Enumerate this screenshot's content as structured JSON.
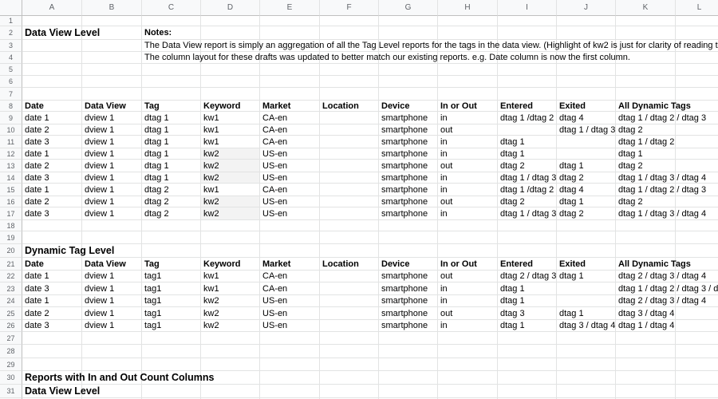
{
  "sheet": {
    "columns": [
      "A",
      "B",
      "C",
      "D",
      "E",
      "F",
      "G",
      "H",
      "I",
      "J",
      "K",
      "L"
    ],
    "rows": [
      {
        "n": "1",
        "cells": []
      },
      {
        "n": "2",
        "cells": [
          {
            "c": 0,
            "v": "Data View Level",
            "s": "big"
          },
          {
            "c": 2,
            "v": "Notes:",
            "s": "bold"
          }
        ]
      },
      {
        "n": "3",
        "cells": [
          {
            "c": 2,
            "v": "The Data View report is simply an aggregation of all the Tag Level reports for the tags in the data view. (Highlight of kw2 is just for clarity of reading this"
          }
        ]
      },
      {
        "n": "4",
        "cells": [
          {
            "c": 2,
            "v": "The column layout for these drafts was updated to better match our existing reports. e.g. Date column is now the first column."
          }
        ]
      },
      {
        "n": "5",
        "cells": []
      },
      {
        "n": "6",
        "cells": []
      },
      {
        "n": "7",
        "cells": []
      },
      {
        "n": "8",
        "cells": [
          {
            "c": 0,
            "v": "Date",
            "s": "bold"
          },
          {
            "c": 1,
            "v": "Data View",
            "s": "bold"
          },
          {
            "c": 2,
            "v": "Tag",
            "s": "bold"
          },
          {
            "c": 3,
            "v": "Keyword",
            "s": "bold"
          },
          {
            "c": 4,
            "v": "Market",
            "s": "bold"
          },
          {
            "c": 5,
            "v": "Location",
            "s": "bold"
          },
          {
            "c": 6,
            "v": "Device",
            "s": "bold"
          },
          {
            "c": 7,
            "v": "In or Out",
            "s": "bold"
          },
          {
            "c": 8,
            "v": "Entered",
            "s": "bold"
          },
          {
            "c": 9,
            "v": "Exited",
            "s": "bold"
          },
          {
            "c": 10,
            "v": "All Dynamic Tags",
            "s": "bold"
          }
        ]
      },
      {
        "n": "9",
        "cells": [
          {
            "c": 0,
            "v": "date 1"
          },
          {
            "c": 1,
            "v": "dview 1"
          },
          {
            "c": 2,
            "v": "dtag 1"
          },
          {
            "c": 3,
            "v": "kw1"
          },
          {
            "c": 4,
            "v": "CA-en"
          },
          {
            "c": 6,
            "v": "smartphone"
          },
          {
            "c": 7,
            "v": "in"
          },
          {
            "c": 8,
            "v": "dtag 1 /dtag 2"
          },
          {
            "c": 9,
            "v": "dtag 4"
          },
          {
            "c": 10,
            "v": "dtag 1 / dtag 2 / dtag 3"
          }
        ]
      },
      {
        "n": "10",
        "cells": [
          {
            "c": 0,
            "v": "date 2"
          },
          {
            "c": 1,
            "v": "dview 1"
          },
          {
            "c": 2,
            "v": "dtag 1"
          },
          {
            "c": 3,
            "v": "kw1"
          },
          {
            "c": 4,
            "v": "CA-en"
          },
          {
            "c": 6,
            "v": "smartphone"
          },
          {
            "c": 7,
            "v": "out"
          },
          {
            "c": 9,
            "v": "dtag 1 / dtag 3"
          },
          {
            "c": 10,
            "v": "dtag 2"
          }
        ]
      },
      {
        "n": "11",
        "cells": [
          {
            "c": 0,
            "v": "date 3"
          },
          {
            "c": 1,
            "v": "dview 1"
          },
          {
            "c": 2,
            "v": "dtag 1"
          },
          {
            "c": 3,
            "v": "kw1"
          },
          {
            "c": 4,
            "v": "CA-en"
          },
          {
            "c": 6,
            "v": "smartphone"
          },
          {
            "c": 7,
            "v": "in"
          },
          {
            "c": 8,
            "v": "dtag 1"
          },
          {
            "c": 10,
            "v": "dtag 1 / dtag 2"
          }
        ]
      },
      {
        "n": "12",
        "cells": [
          {
            "c": 0,
            "v": "date 1"
          },
          {
            "c": 1,
            "v": "dview 1"
          },
          {
            "c": 2,
            "v": "dtag 1"
          },
          {
            "c": 3,
            "v": "kw2",
            "s": "shade"
          },
          {
            "c": 4,
            "v": "US-en"
          },
          {
            "c": 6,
            "v": "smartphone"
          },
          {
            "c": 7,
            "v": "in"
          },
          {
            "c": 8,
            "v": "dtag 1"
          },
          {
            "c": 10,
            "v": "dtag 1"
          }
        ]
      },
      {
        "n": "13",
        "cells": [
          {
            "c": 0,
            "v": "date 2"
          },
          {
            "c": 1,
            "v": "dview 1"
          },
          {
            "c": 2,
            "v": "dtag 1"
          },
          {
            "c": 3,
            "v": "kw2",
            "s": "shade"
          },
          {
            "c": 4,
            "v": "US-en"
          },
          {
            "c": 6,
            "v": "smartphone"
          },
          {
            "c": 7,
            "v": "out"
          },
          {
            "c": 8,
            "v": "dtag 2"
          },
          {
            "c": 9,
            "v": "dtag 1"
          },
          {
            "c": 10,
            "v": "dtag 2"
          }
        ]
      },
      {
        "n": "14",
        "cells": [
          {
            "c": 0,
            "v": "date 3"
          },
          {
            "c": 1,
            "v": "dview 1"
          },
          {
            "c": 2,
            "v": "dtag 1"
          },
          {
            "c": 3,
            "v": "kw2",
            "s": "shade"
          },
          {
            "c": 4,
            "v": "US-en"
          },
          {
            "c": 6,
            "v": "smartphone"
          },
          {
            "c": 7,
            "v": "in"
          },
          {
            "c": 8,
            "v": "dtag 1 / dtag 3"
          },
          {
            "c": 9,
            "v": "dtag 2"
          },
          {
            "c": 10,
            "v": "dtag 1 / dtag 3 / dtag 4"
          }
        ]
      },
      {
        "n": "15",
        "cells": [
          {
            "c": 0,
            "v": "date 1"
          },
          {
            "c": 1,
            "v": "dview 1"
          },
          {
            "c": 2,
            "v": "dtag 2"
          },
          {
            "c": 3,
            "v": "kw1"
          },
          {
            "c": 4,
            "v": "CA-en"
          },
          {
            "c": 6,
            "v": "smartphone"
          },
          {
            "c": 7,
            "v": "in"
          },
          {
            "c": 8,
            "v": "dtag 1 /dtag 2"
          },
          {
            "c": 9,
            "v": "dtag 4"
          },
          {
            "c": 10,
            "v": "dtag 1 / dtag 2 / dtag 3"
          }
        ]
      },
      {
        "n": "16",
        "cells": [
          {
            "c": 0,
            "v": "date 2"
          },
          {
            "c": 1,
            "v": "dview 1"
          },
          {
            "c": 2,
            "v": "dtag 2"
          },
          {
            "c": 3,
            "v": "kw2",
            "s": "shade"
          },
          {
            "c": 4,
            "v": "US-en"
          },
          {
            "c": 6,
            "v": "smartphone"
          },
          {
            "c": 7,
            "v": "out"
          },
          {
            "c": 8,
            "v": "dtag 2"
          },
          {
            "c": 9,
            "v": "dtag 1"
          },
          {
            "c": 10,
            "v": "dtag 2"
          }
        ]
      },
      {
        "n": "17",
        "cells": [
          {
            "c": 0,
            "v": "date 3"
          },
          {
            "c": 1,
            "v": "dview 1"
          },
          {
            "c": 2,
            "v": "dtag 2"
          },
          {
            "c": 3,
            "v": "kw2",
            "s": "shade"
          },
          {
            "c": 4,
            "v": "US-en"
          },
          {
            "c": 6,
            "v": "smartphone"
          },
          {
            "c": 7,
            "v": "in"
          },
          {
            "c": 8,
            "v": "dtag 1 / dtag 3"
          },
          {
            "c": 9,
            "v": "dtag 2"
          },
          {
            "c": 10,
            "v": "dtag 1 / dtag 3 / dtag 4"
          }
        ]
      },
      {
        "n": "18",
        "cells": []
      },
      {
        "n": "19",
        "cells": []
      },
      {
        "n": "20",
        "cells": [
          {
            "c": 0,
            "v": "Dynamic Tag Level",
            "s": "big"
          }
        ]
      },
      {
        "n": "21",
        "cells": [
          {
            "c": 0,
            "v": "Date",
            "s": "bold"
          },
          {
            "c": 1,
            "v": "Data View",
            "s": "bold"
          },
          {
            "c": 2,
            "v": "Tag",
            "s": "bold"
          },
          {
            "c": 3,
            "v": "Keyword",
            "s": "bold"
          },
          {
            "c": 4,
            "v": "Market",
            "s": "bold"
          },
          {
            "c": 5,
            "v": "Location",
            "s": "bold"
          },
          {
            "c": 6,
            "v": "Device",
            "s": "bold"
          },
          {
            "c": 7,
            "v": "In or Out",
            "s": "bold"
          },
          {
            "c": 8,
            "v": "Entered",
            "s": "bold"
          },
          {
            "c": 9,
            "v": "Exited",
            "s": "bold"
          },
          {
            "c": 10,
            "v": "All Dynamic Tags",
            "s": "bold"
          }
        ]
      },
      {
        "n": "22",
        "cells": [
          {
            "c": 0,
            "v": "date 1"
          },
          {
            "c": 1,
            "v": "dview 1"
          },
          {
            "c": 2,
            "v": "tag1"
          },
          {
            "c": 3,
            "v": "kw1"
          },
          {
            "c": 4,
            "v": "CA-en"
          },
          {
            "c": 6,
            "v": "smartphone"
          },
          {
            "c": 7,
            "v": "out"
          },
          {
            "c": 8,
            "v": "dtag 2 / dtag 3"
          },
          {
            "c": 9,
            "v": "dtag 1"
          },
          {
            "c": 10,
            "v": "dtag 2 / dtag 3 / dtag 4"
          }
        ]
      },
      {
        "n": "23",
        "cells": [
          {
            "c": 0,
            "v": "date 3"
          },
          {
            "c": 1,
            "v": "dview 1"
          },
          {
            "c": 2,
            "v": "tag1"
          },
          {
            "c": 3,
            "v": "kw1"
          },
          {
            "c": 4,
            "v": "CA-en"
          },
          {
            "c": 6,
            "v": "smartphone"
          },
          {
            "c": 7,
            "v": "in"
          },
          {
            "c": 8,
            "v": "dtag 1"
          },
          {
            "c": 10,
            "v": "dtag 1 / dtag 2 / dtag 3 / d"
          }
        ]
      },
      {
        "n": "24",
        "cells": [
          {
            "c": 0,
            "v": "date 1"
          },
          {
            "c": 1,
            "v": "dview 1"
          },
          {
            "c": 2,
            "v": "tag1"
          },
          {
            "c": 3,
            "v": "kw2"
          },
          {
            "c": 4,
            "v": "US-en"
          },
          {
            "c": 6,
            "v": "smartphone"
          },
          {
            "c": 7,
            "v": "in"
          },
          {
            "c": 8,
            "v": "dtag 1"
          },
          {
            "c": 10,
            "v": "dtag 2 / dtag 3 / dtag 4"
          }
        ]
      },
      {
        "n": "25",
        "cells": [
          {
            "c": 0,
            "v": "date 2"
          },
          {
            "c": 1,
            "v": "dview 1"
          },
          {
            "c": 2,
            "v": "tag1"
          },
          {
            "c": 3,
            "v": "kw2"
          },
          {
            "c": 4,
            "v": "US-en"
          },
          {
            "c": 6,
            "v": "smartphone"
          },
          {
            "c": 7,
            "v": "out"
          },
          {
            "c": 8,
            "v": "dtag 3"
          },
          {
            "c": 9,
            "v": "dtag 1"
          },
          {
            "c": 10,
            "v": "dtag 3 / dtag 4"
          }
        ]
      },
      {
        "n": "26",
        "cells": [
          {
            "c": 0,
            "v": "date 3"
          },
          {
            "c": 1,
            "v": "dview 1"
          },
          {
            "c": 2,
            "v": "tag1"
          },
          {
            "c": 3,
            "v": "kw2"
          },
          {
            "c": 4,
            "v": "US-en"
          },
          {
            "c": 6,
            "v": "smartphone"
          },
          {
            "c": 7,
            "v": "in"
          },
          {
            "c": 8,
            "v": "dtag 1"
          },
          {
            "c": 9,
            "v": "dtag 3 / dtag 4"
          },
          {
            "c": 10,
            "v": "dtag 1 / dtag 4"
          }
        ]
      },
      {
        "n": "27",
        "cells": []
      },
      {
        "n": "28",
        "cells": []
      },
      {
        "n": "29",
        "cells": []
      },
      {
        "n": "30",
        "cells": [
          {
            "c": 0,
            "v": "Reports with In and Out Count Columns",
            "s": "big"
          }
        ]
      },
      {
        "n": "31",
        "cells": [
          {
            "c": 0,
            "v": "Data View Level",
            "s": "big"
          }
        ]
      },
      {
        "n": "32",
        "cells": []
      }
    ]
  }
}
